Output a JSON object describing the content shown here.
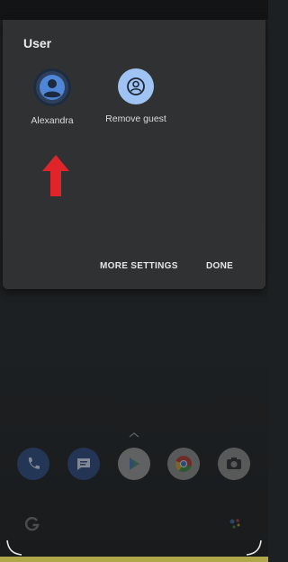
{
  "dialog": {
    "title": "User",
    "users": [
      {
        "label": "Alexandra",
        "icon": "person-icon",
        "selected": true
      },
      {
        "label": "Remove guest",
        "icon": "account-circle-icon",
        "selected": false
      }
    ],
    "actions": {
      "more_settings": "MORE SETTINGS",
      "done": "DONE"
    },
    "annotation_arrow_color": "#e0252a"
  },
  "dock": {
    "apps": [
      "phone-icon",
      "messages-icon",
      "play-store-icon",
      "chrome-icon",
      "camera-icon"
    ]
  },
  "colors": {
    "dialog_bg": "#303133",
    "screen_bg": "#1d2022",
    "guest_avatar": "#9fc3f2",
    "selected_avatar": "#2d3f5a"
  }
}
